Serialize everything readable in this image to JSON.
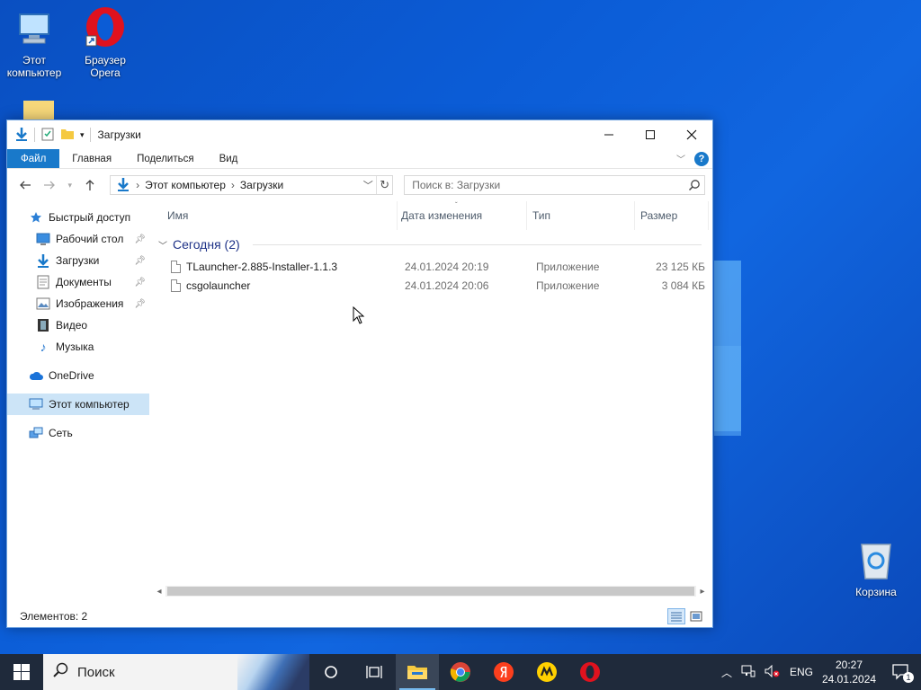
{
  "colors": {
    "accent": "#1979ca",
    "selection": "#cce4f7",
    "taskbar": "#1f2a3b",
    "desktop": "#0b5cd6"
  },
  "desktop": {
    "icons": [
      {
        "label_line1": "Этот",
        "label_line2": "компьютер",
        "icon": "this-pc-icon"
      },
      {
        "label_line1": "Браузер",
        "label_line2": "Opera",
        "icon": "opera-icon"
      },
      {
        "label_line1": "Корзина",
        "label_line2": "",
        "icon": "recycle-bin-icon"
      }
    ]
  },
  "window": {
    "title": "Загрузки",
    "ribbon": {
      "tabs": [
        "Файл",
        "Главная",
        "Поделиться",
        "Вид"
      ]
    },
    "address": {
      "segments": [
        "Этот компьютер",
        "Загрузки"
      ]
    },
    "search": {
      "placeholder": "Поиск в: Загрузки"
    },
    "nav": {
      "items": [
        {
          "label": "Быстрый доступ",
          "icon": "star-icon"
        },
        {
          "label": "Рабочий стол",
          "icon": "desktop-icon",
          "pinned": true
        },
        {
          "label": "Загрузки",
          "icon": "download-icon",
          "pinned": true
        },
        {
          "label": "Документы",
          "icon": "documents-icon",
          "pinned": true
        },
        {
          "label": "Изображения",
          "icon": "pictures-icon",
          "pinned": true
        },
        {
          "label": "Видео",
          "icon": "video-icon"
        },
        {
          "label": "Музыка",
          "icon": "music-icon"
        },
        {
          "label": "OneDrive",
          "icon": "cloud-icon"
        },
        {
          "label": "Этот компьютер",
          "icon": "computer-icon",
          "selected": true
        },
        {
          "label": "Сеть",
          "icon": "network-icon"
        }
      ]
    },
    "columns": {
      "name": "Имя",
      "date": "Дата изменения",
      "type": "Тип",
      "size": "Размер"
    },
    "group": {
      "label": "Сегодня (2)"
    },
    "files": [
      {
        "name": "TLauncher-2.885-Installer-1.1.3",
        "date": "24.01.2024 20:19",
        "type": "Приложение",
        "size": "23 125 КБ"
      },
      {
        "name": "csgolauncher",
        "date": "24.01.2024 20:06",
        "type": "Приложение",
        "size": "3 084 КБ"
      }
    ],
    "status": {
      "count": "Элементов: 2"
    }
  },
  "taskbar": {
    "search_label": "Поиск",
    "lang": "ENG",
    "time": "20:27",
    "date": "24.01.2024",
    "notifications": "1"
  }
}
